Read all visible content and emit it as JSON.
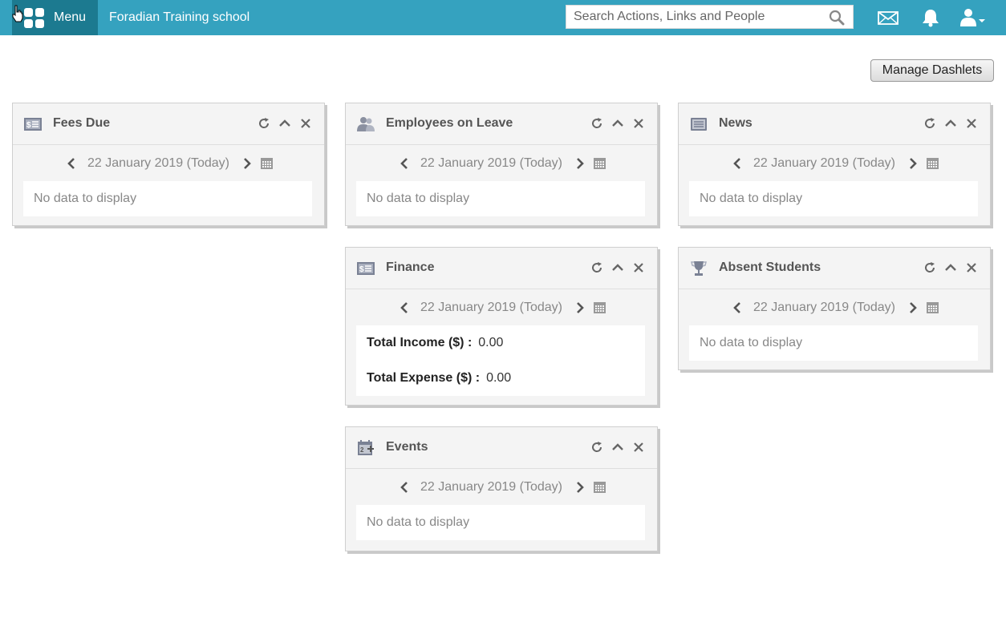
{
  "header": {
    "menu_label": "Menu",
    "school_name": "Foradian Training school",
    "search_placeholder": "Search Actions, Links and People"
  },
  "manage_dashlets_label": "Manage Dashlets",
  "no_data_text": "No data to display",
  "dashlets": {
    "fees_due": {
      "title": "Fees Due",
      "date": "22 January 2019 (Today)"
    },
    "employees_on_leave": {
      "title": "Employees on Leave",
      "date": "22 January 2019 (Today)"
    },
    "news": {
      "title": "News",
      "date": "22 January 2019 (Today)"
    },
    "finance": {
      "title": "Finance",
      "date": "22 January 2019 (Today)",
      "total_income_label": "Total Income ($) :",
      "total_income_value": "0.00",
      "total_expense_label": "Total Expense ($) :",
      "total_expense_value": "0.00"
    },
    "absent_students": {
      "title": "Absent Students",
      "date": "22 January 2019 (Today)"
    },
    "events": {
      "title": "Events",
      "date": "22 January 2019 (Today)"
    }
  },
  "colors": {
    "topbar": "#35a2bf",
    "menu_bg": "#1c7a90",
    "dashlet_bg": "#f4f4f4"
  },
  "icons": [
    "grid-menu-icon",
    "search-icon",
    "mail-icon",
    "bell-icon",
    "user-icon",
    "money-icon",
    "employees-icon",
    "news-icon",
    "trophy-icon",
    "calendar-add-icon",
    "refresh-icon",
    "chevron-up-icon",
    "close-icon",
    "chevron-left-icon",
    "chevron-right-icon",
    "calendar-icon"
  ]
}
